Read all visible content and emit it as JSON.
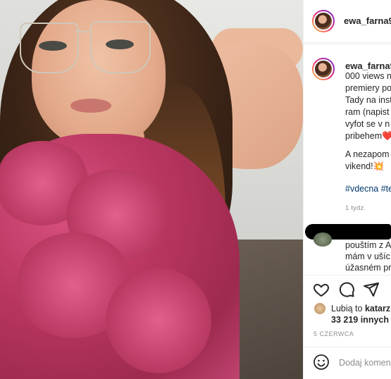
{
  "post": {
    "username": "ewa_farna9",
    "caption_lines": [
      "000 views n",
      "premiery po",
      "Tady na inst",
      "ram (napist",
      "vyfot se v n",
      "pribehem❤️"
    ],
    "caption_line2_a": "A nezapom",
    "caption_line2_b": "vikend!💥",
    "hashtags": "#vdecna #te",
    "posted_ago": "1 tydz."
  },
  "comment": {
    "lines": [
      "pouštím z A",
      "mám v ušíc",
      "úžasném pr"
    ]
  },
  "actions": {
    "like_icon": "heart-icon",
    "comment_icon": "comment-icon",
    "share_icon": "share-icon"
  },
  "likes": {
    "prefix": "Lubią to",
    "name": "katarz",
    "others": "33 219 innych u"
  },
  "date": "5 CZERWCA",
  "add_comment": {
    "placeholder": "Dodaj komen",
    "emoji_icon": "smiley-icon"
  },
  "colors": {
    "link": "#00376b",
    "muted": "#8e8e8e",
    "text": "#262626"
  }
}
